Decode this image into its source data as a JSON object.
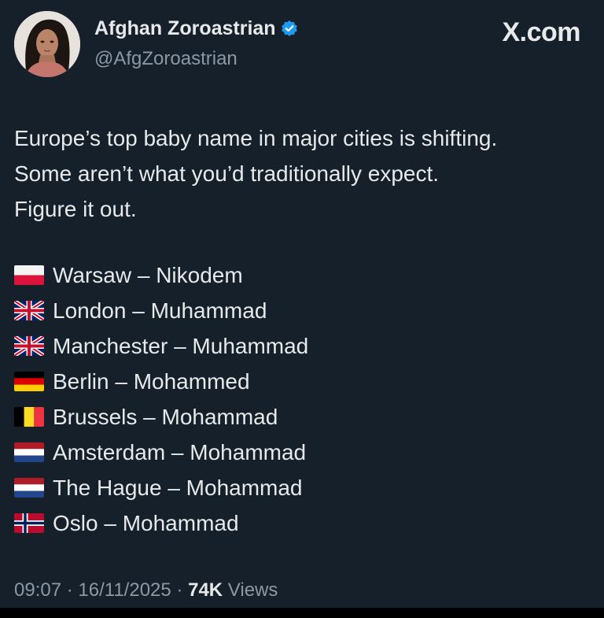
{
  "author": {
    "display_name": "Afghan Zoroastrian",
    "handle": "@AfgZoroastrian",
    "verified": true,
    "accent_color": "#1d9bf0"
  },
  "watermark": "X.com",
  "tweet": {
    "lines": [
      "Europe’s top baby name in major cities is shifting.",
      "Some aren’t what you’d traditionally expect.",
      "Figure it out."
    ],
    "cities": [
      {
        "flag": "poland-flag-icon",
        "text": "Warsaw – Nikodem"
      },
      {
        "flag": "uk-flag-icon",
        "text": "London – Muhammad"
      },
      {
        "flag": "uk-flag-icon",
        "text": "Manchester – Muhammad"
      },
      {
        "flag": "germany-flag-icon",
        "text": "Berlin – Mohammed"
      },
      {
        "flag": "belgium-flag-icon",
        "text": "Brussels – Mohammad"
      },
      {
        "flag": "netherlands-flag-icon",
        "text": "Amsterdam – Mohammad"
      },
      {
        "flag": "netherlands-flag-icon",
        "text": "The Hague – Mohammad"
      },
      {
        "flag": "norway-flag-icon",
        "text": "Oslo – Mohammad"
      }
    ]
  },
  "meta": {
    "time": "09:07",
    "date": "16/11/2025",
    "views_count": "74K",
    "views_label": "Views",
    "separator": "·"
  },
  "colors": {
    "background": "#15202b",
    "text": "#e7e9ea",
    "secondary_text": "#8b98a5"
  }
}
